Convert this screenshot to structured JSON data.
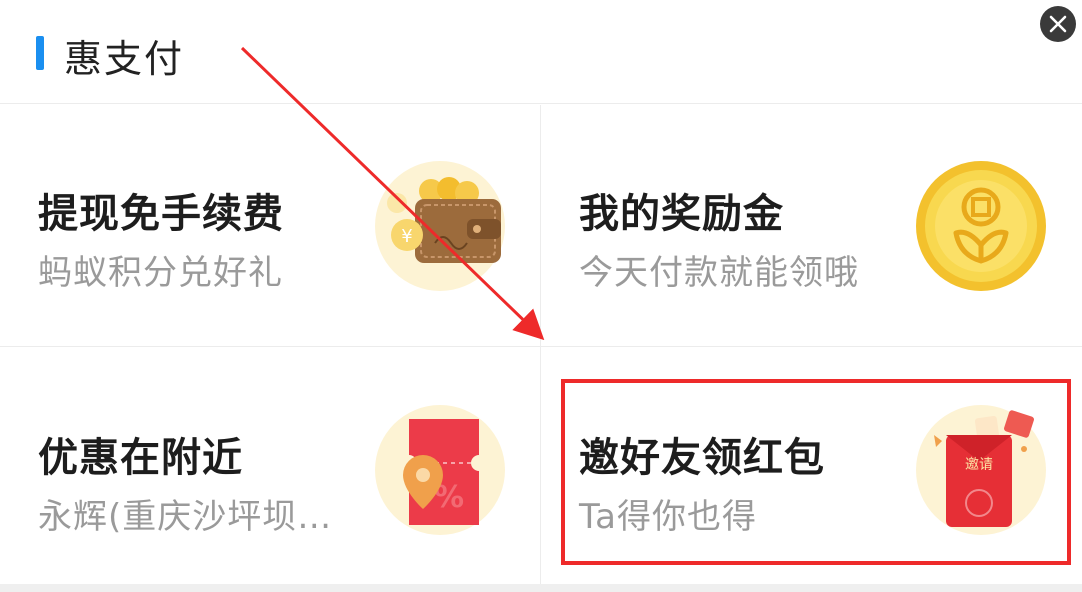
{
  "header": {
    "title": "惠支付",
    "accent_color": "#1a8ff0",
    "close_icon": "close-icon"
  },
  "cards": [
    {
      "title": "提现免手续费",
      "subtitle": "蚂蚁积分兑好礼",
      "icon": "wallet-icon"
    },
    {
      "title": "我的奖励金",
      "subtitle": "今天付款就能领哦",
      "icon": "gold-coin-icon"
    },
    {
      "title": "优惠在附近",
      "subtitle": "永辉(重庆沙坪坝…",
      "icon": "coupon-location-icon"
    },
    {
      "title": "邀好友领红包",
      "subtitle": "Ta得你也得",
      "icon": "red-envelope-icon",
      "envelope_label": "邀请"
    }
  ],
  "annotation": {
    "highlight_color": "#ee2a2a",
    "highlighted_card": 3
  }
}
